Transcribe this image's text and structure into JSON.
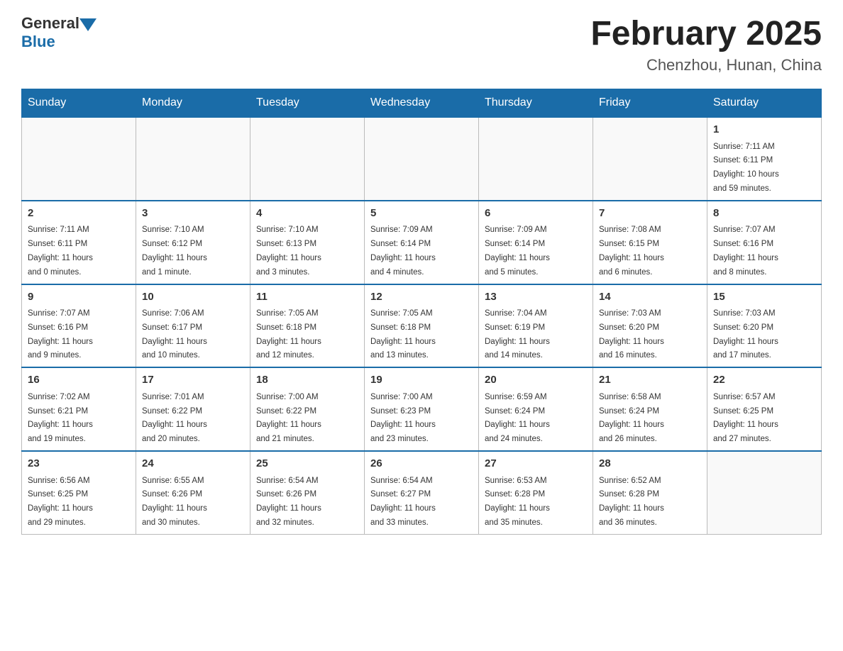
{
  "header": {
    "logo": {
      "text1": "General",
      "text2": "Blue"
    },
    "title": "February 2025",
    "location": "Chenzhou, Hunan, China"
  },
  "days_of_week": [
    "Sunday",
    "Monday",
    "Tuesday",
    "Wednesday",
    "Thursday",
    "Friday",
    "Saturday"
  ],
  "weeks": [
    [
      {
        "day": "",
        "info": ""
      },
      {
        "day": "",
        "info": ""
      },
      {
        "day": "",
        "info": ""
      },
      {
        "day": "",
        "info": ""
      },
      {
        "day": "",
        "info": ""
      },
      {
        "day": "",
        "info": ""
      },
      {
        "day": "1",
        "info": "Sunrise: 7:11 AM\nSunset: 6:11 PM\nDaylight: 10 hours\nand 59 minutes."
      }
    ],
    [
      {
        "day": "2",
        "info": "Sunrise: 7:11 AM\nSunset: 6:11 PM\nDaylight: 11 hours\nand 0 minutes."
      },
      {
        "day": "3",
        "info": "Sunrise: 7:10 AM\nSunset: 6:12 PM\nDaylight: 11 hours\nand 1 minute."
      },
      {
        "day": "4",
        "info": "Sunrise: 7:10 AM\nSunset: 6:13 PM\nDaylight: 11 hours\nand 3 minutes."
      },
      {
        "day": "5",
        "info": "Sunrise: 7:09 AM\nSunset: 6:14 PM\nDaylight: 11 hours\nand 4 minutes."
      },
      {
        "day": "6",
        "info": "Sunrise: 7:09 AM\nSunset: 6:14 PM\nDaylight: 11 hours\nand 5 minutes."
      },
      {
        "day": "7",
        "info": "Sunrise: 7:08 AM\nSunset: 6:15 PM\nDaylight: 11 hours\nand 6 minutes."
      },
      {
        "day": "8",
        "info": "Sunrise: 7:07 AM\nSunset: 6:16 PM\nDaylight: 11 hours\nand 8 minutes."
      }
    ],
    [
      {
        "day": "9",
        "info": "Sunrise: 7:07 AM\nSunset: 6:16 PM\nDaylight: 11 hours\nand 9 minutes."
      },
      {
        "day": "10",
        "info": "Sunrise: 7:06 AM\nSunset: 6:17 PM\nDaylight: 11 hours\nand 10 minutes."
      },
      {
        "day": "11",
        "info": "Sunrise: 7:05 AM\nSunset: 6:18 PM\nDaylight: 11 hours\nand 12 minutes."
      },
      {
        "day": "12",
        "info": "Sunrise: 7:05 AM\nSunset: 6:18 PM\nDaylight: 11 hours\nand 13 minutes."
      },
      {
        "day": "13",
        "info": "Sunrise: 7:04 AM\nSunset: 6:19 PM\nDaylight: 11 hours\nand 14 minutes."
      },
      {
        "day": "14",
        "info": "Sunrise: 7:03 AM\nSunset: 6:20 PM\nDaylight: 11 hours\nand 16 minutes."
      },
      {
        "day": "15",
        "info": "Sunrise: 7:03 AM\nSunset: 6:20 PM\nDaylight: 11 hours\nand 17 minutes."
      }
    ],
    [
      {
        "day": "16",
        "info": "Sunrise: 7:02 AM\nSunset: 6:21 PM\nDaylight: 11 hours\nand 19 minutes."
      },
      {
        "day": "17",
        "info": "Sunrise: 7:01 AM\nSunset: 6:22 PM\nDaylight: 11 hours\nand 20 minutes."
      },
      {
        "day": "18",
        "info": "Sunrise: 7:00 AM\nSunset: 6:22 PM\nDaylight: 11 hours\nand 21 minutes."
      },
      {
        "day": "19",
        "info": "Sunrise: 7:00 AM\nSunset: 6:23 PM\nDaylight: 11 hours\nand 23 minutes."
      },
      {
        "day": "20",
        "info": "Sunrise: 6:59 AM\nSunset: 6:24 PM\nDaylight: 11 hours\nand 24 minutes."
      },
      {
        "day": "21",
        "info": "Sunrise: 6:58 AM\nSunset: 6:24 PM\nDaylight: 11 hours\nand 26 minutes."
      },
      {
        "day": "22",
        "info": "Sunrise: 6:57 AM\nSunset: 6:25 PM\nDaylight: 11 hours\nand 27 minutes."
      }
    ],
    [
      {
        "day": "23",
        "info": "Sunrise: 6:56 AM\nSunset: 6:25 PM\nDaylight: 11 hours\nand 29 minutes."
      },
      {
        "day": "24",
        "info": "Sunrise: 6:55 AM\nSunset: 6:26 PM\nDaylight: 11 hours\nand 30 minutes."
      },
      {
        "day": "25",
        "info": "Sunrise: 6:54 AM\nSunset: 6:26 PM\nDaylight: 11 hours\nand 32 minutes."
      },
      {
        "day": "26",
        "info": "Sunrise: 6:54 AM\nSunset: 6:27 PM\nDaylight: 11 hours\nand 33 minutes."
      },
      {
        "day": "27",
        "info": "Sunrise: 6:53 AM\nSunset: 6:28 PM\nDaylight: 11 hours\nand 35 minutes."
      },
      {
        "day": "28",
        "info": "Sunrise: 6:52 AM\nSunset: 6:28 PM\nDaylight: 11 hours\nand 36 minutes."
      },
      {
        "day": "",
        "info": ""
      }
    ]
  ]
}
